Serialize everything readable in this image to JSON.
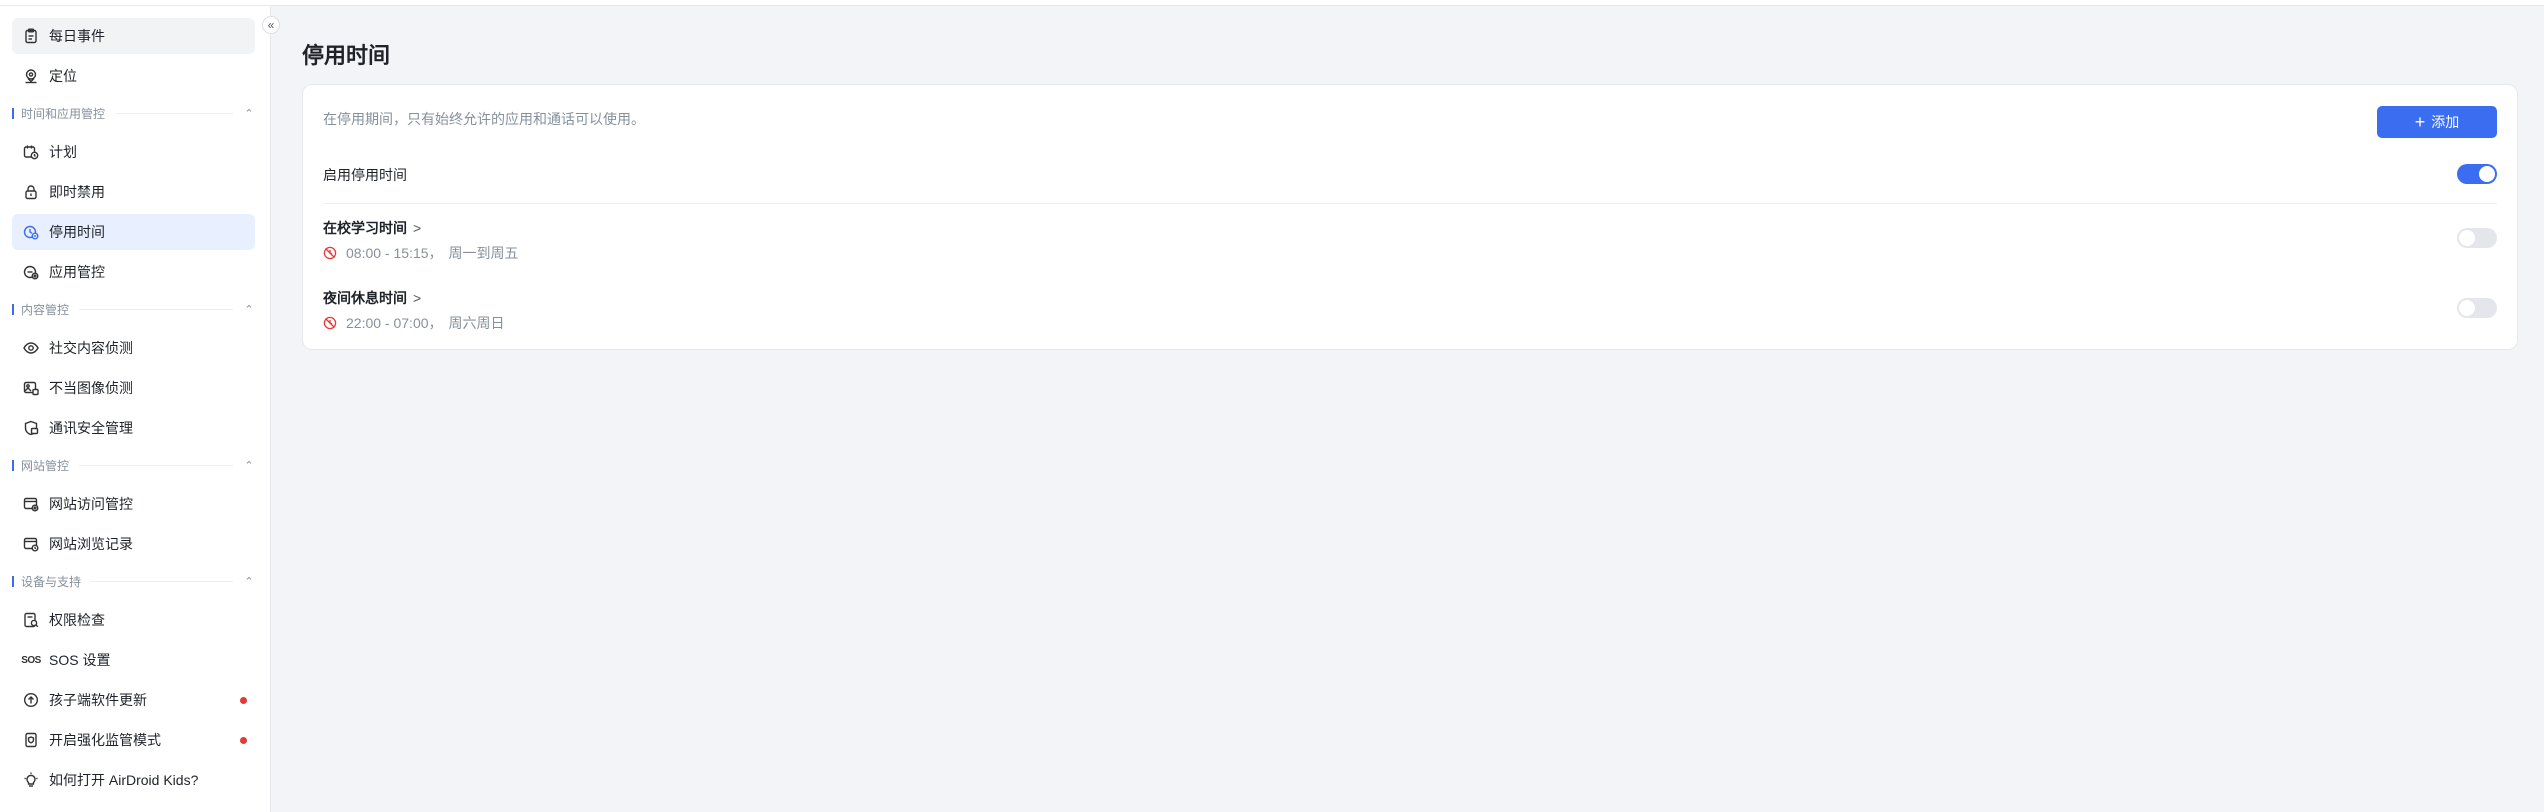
{
  "sidebar": {
    "top_items": [
      {
        "label": "每日事件",
        "icon": "clipboard-icon"
      },
      {
        "label": "定位",
        "icon": "location-icon"
      }
    ],
    "sections": [
      {
        "title": "时间和应用管控",
        "items": [
          {
            "label": "计划",
            "icon": "calendar-clock-icon"
          },
          {
            "label": "即时禁用",
            "icon": "lock-icon"
          },
          {
            "label": "停用时间",
            "icon": "downtime-icon",
            "active": true
          },
          {
            "label": "应用管控",
            "icon": "app-control-icon"
          }
        ]
      },
      {
        "title": "内容管控",
        "items": [
          {
            "label": "社交内容侦测",
            "icon": "eye-icon"
          },
          {
            "label": "不当图像侦测",
            "icon": "image-icon"
          },
          {
            "label": "通讯安全管理",
            "icon": "shield-chat-icon"
          }
        ]
      },
      {
        "title": "网站管控",
        "items": [
          {
            "label": "网站访问管控",
            "icon": "browser-gear-icon"
          },
          {
            "label": "网站浏览记录",
            "icon": "browser-clock-icon"
          }
        ]
      },
      {
        "title": "设备与支持",
        "items": [
          {
            "label": "权限检查",
            "icon": "permission-check-icon"
          },
          {
            "label": "SOS 设置",
            "icon": "sos-icon",
            "icon_text": "SOS"
          },
          {
            "label": "孩子端软件更新",
            "icon": "upload-circle-icon",
            "badge": true
          },
          {
            "label": "开启强化监管模式",
            "icon": "phone-shield-icon",
            "badge": true
          },
          {
            "label": "如何打开 AirDroid Kids?",
            "icon": "lightbulb-icon"
          }
        ]
      }
    ]
  },
  "main": {
    "title": "停用时间",
    "description": "在停用期间，只有始终允许的应用和通话可以使用。",
    "add_label": "添加",
    "enable_label": "启用停用时间",
    "enable_on": true,
    "schedules": [
      {
        "name": "在校学习时间",
        "time": "08:00 - 15:15，",
        "days": "周一到周五",
        "enabled": false
      },
      {
        "name": "夜间休息时间",
        "time": "22:00 - 07:00，",
        "days": "周六周日",
        "enabled": false
      }
    ]
  },
  "colors": {
    "accent": "#3a6df0",
    "active_bg": "#e8efff",
    "badge": "#e53935",
    "clock_icon": "#e53935"
  }
}
